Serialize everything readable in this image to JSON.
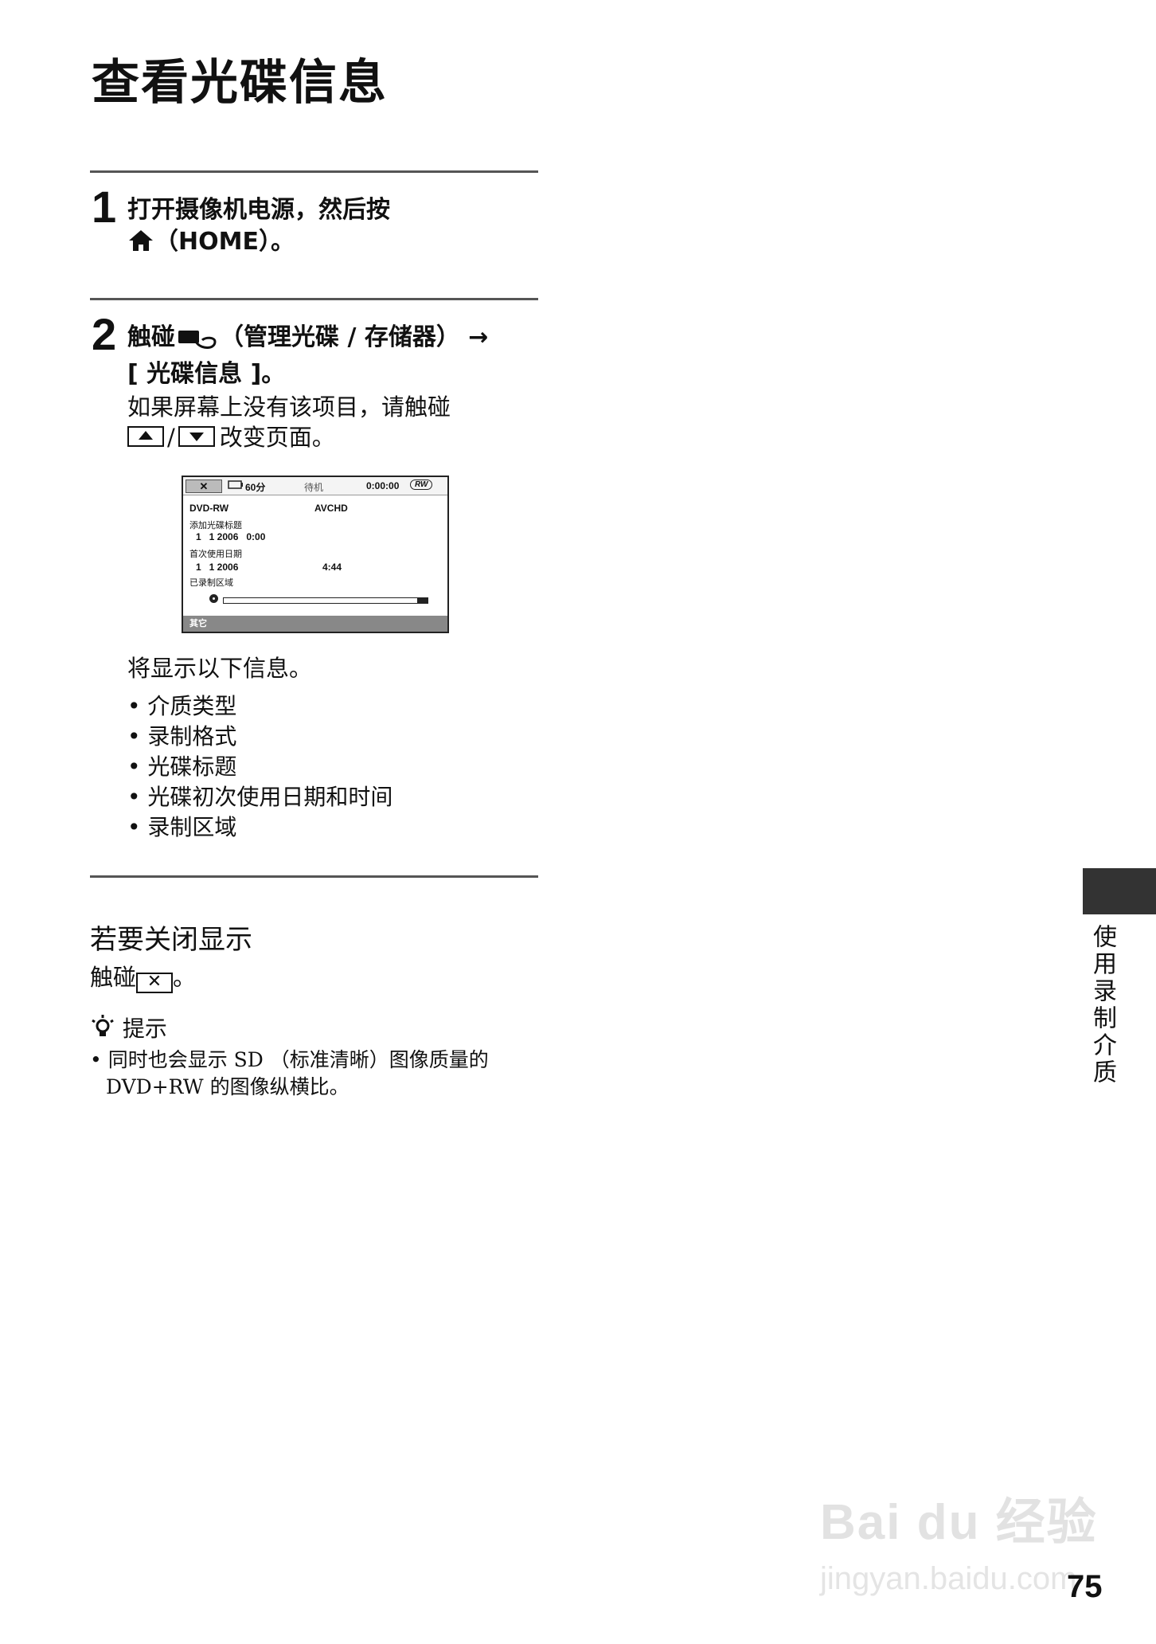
{
  "page": {
    "title": "查看光碟信息",
    "step1": {
      "num": "1",
      "text_line1": "打开摄像机电源，然后按",
      "text_line2": "（HOME）。"
    },
    "step2": {
      "num": "2",
      "text_line1_a": "触碰",
      "text_line1_b": "（管理光碟 / 存储器） →",
      "text_line2": "[ 光碟信息 ]。",
      "note_line1": "如果屏幕上没有该项目，请触碰",
      "note_slash": "/",
      "note_line2_tail": "改变页面。"
    },
    "screen": {
      "close": "✕",
      "battery": "60分",
      "status": "待机",
      "time": "0:00:00",
      "disc_badge": "RW",
      "media": "DVD-RW",
      "format": "AVCHD",
      "label_title": "添加光碟标题",
      "title_value": "1   1 2006   0:00",
      "label_first_use": "首次使用日期",
      "first_use_value": "1   1 2006",
      "remaining": "4:44",
      "label_area": "已录制区域",
      "area_used_fraction": 0.05,
      "footer": "其它"
    },
    "info_intro": "将显示以下信息。",
    "info_items": [
      "介质类型",
      "录制格式",
      "光碟标题",
      "光碟初次使用日期和时间",
      "录制区域"
    ],
    "close_section": {
      "heading": "若要关闭显示",
      "text_a": "触碰",
      "text_b": "。"
    },
    "tips": {
      "heading": "提示",
      "line1": "• 同时也会显示 SD （标准清晰）图像质量的",
      "line2": "DVD+RW 的图像纵横比。"
    },
    "side_tab": "使用录制介质",
    "page_number": "75",
    "watermark_main": "Bai du 经验",
    "watermark_url": "jingyan.baidu.com"
  }
}
